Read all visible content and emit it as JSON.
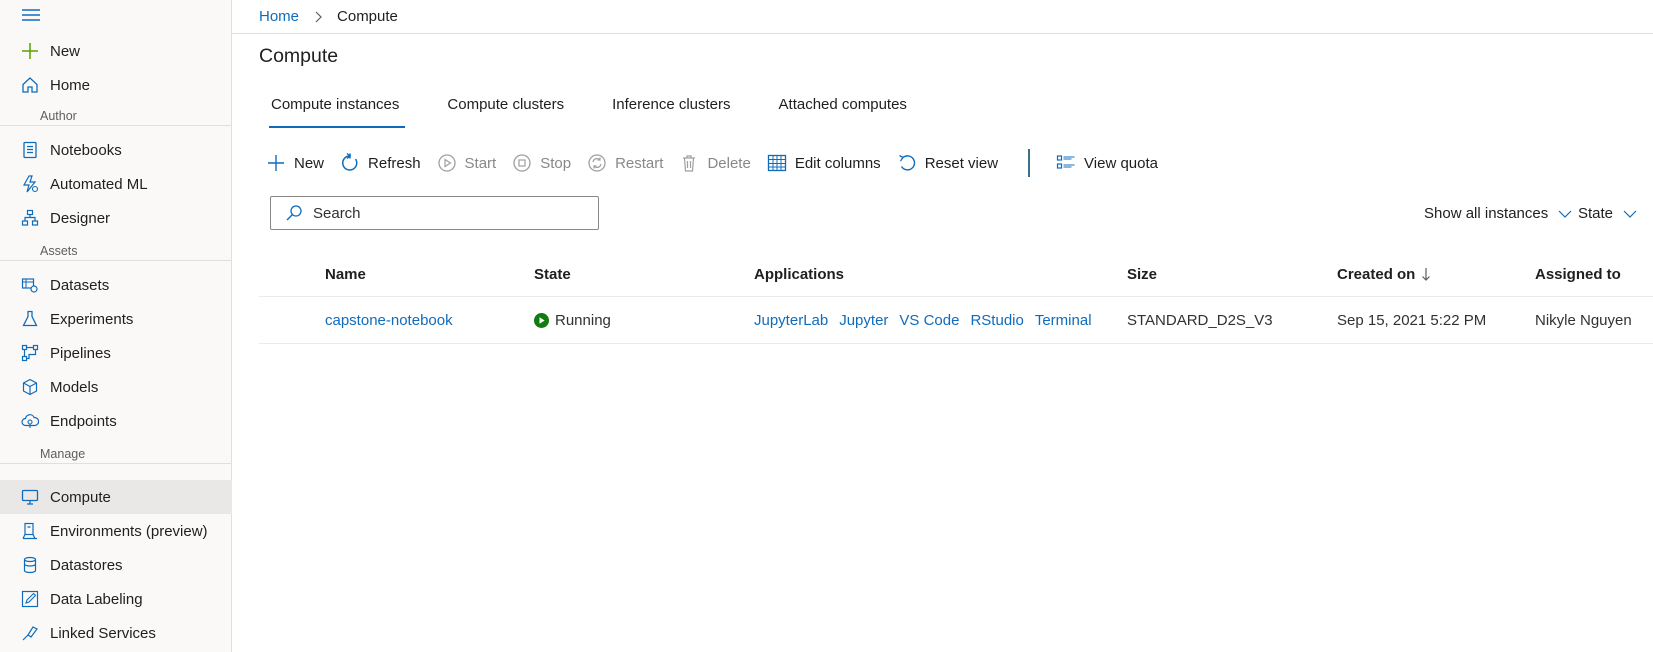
{
  "sidebar": {
    "items": [
      {
        "label": "New",
        "icon": "plus-icon"
      },
      {
        "label": "Home",
        "icon": "home-icon"
      },
      {
        "label": "Notebooks",
        "icon": "notebook-icon"
      },
      {
        "label": "Automated ML",
        "icon": "automl-icon"
      },
      {
        "label": "Designer",
        "icon": "designer-icon"
      },
      {
        "label": "Datasets",
        "icon": "datasets-icon"
      },
      {
        "label": "Experiments",
        "icon": "flask-icon"
      },
      {
        "label": "Pipelines",
        "icon": "pipeline-icon"
      },
      {
        "label": "Models",
        "icon": "cube-icon"
      },
      {
        "label": "Endpoints",
        "icon": "cloud-endpoint-icon"
      },
      {
        "label": "Compute",
        "icon": "monitor-icon"
      },
      {
        "label": "Environments (preview)",
        "icon": "environment-icon"
      },
      {
        "label": "Datastores",
        "icon": "database-icon"
      },
      {
        "label": "Data Labeling",
        "icon": "labeling-icon"
      },
      {
        "label": "Linked Services",
        "icon": "link-icon"
      }
    ],
    "sections": {
      "author": "Author",
      "assets": "Assets",
      "manage": "Manage"
    },
    "active": "Compute"
  },
  "breadcrumb": {
    "home": "Home",
    "current": "Compute"
  },
  "page": {
    "title": "Compute"
  },
  "tabs": [
    {
      "label": "Compute instances",
      "active": true
    },
    {
      "label": "Compute clusters",
      "active": false
    },
    {
      "label": "Inference clusters",
      "active": false
    },
    {
      "label": "Attached computes",
      "active": false
    }
  ],
  "toolbar": {
    "new": "New",
    "refresh": "Refresh",
    "start": "Start",
    "stop": "Stop",
    "restart": "Restart",
    "delete": "Delete",
    "edit_columns": "Edit columns",
    "reset_view": "Reset view",
    "view_quota": "View quota"
  },
  "search": {
    "placeholder": "Search"
  },
  "filters": {
    "instances": "Show all instances",
    "state": "State"
  },
  "table": {
    "columns": {
      "name": "Name",
      "state": "State",
      "applications": "Applications",
      "size": "Size",
      "created_on": "Created on",
      "assigned_to": "Assigned to"
    },
    "rows": [
      {
        "name": "capstone-notebook",
        "state": "Running",
        "applications": [
          "JupyterLab",
          "Jupyter",
          "VS Code",
          "RStudio",
          "Terminal"
        ],
        "size": "STANDARD_D2S_V3",
        "created_on": "Sep 15, 2021 5:22 PM",
        "assigned_to": "Nikyle Nguyen"
      }
    ]
  },
  "colors": {
    "accent": "#0f6cbd",
    "running": "#107c10",
    "disabled": "#8a8886"
  }
}
